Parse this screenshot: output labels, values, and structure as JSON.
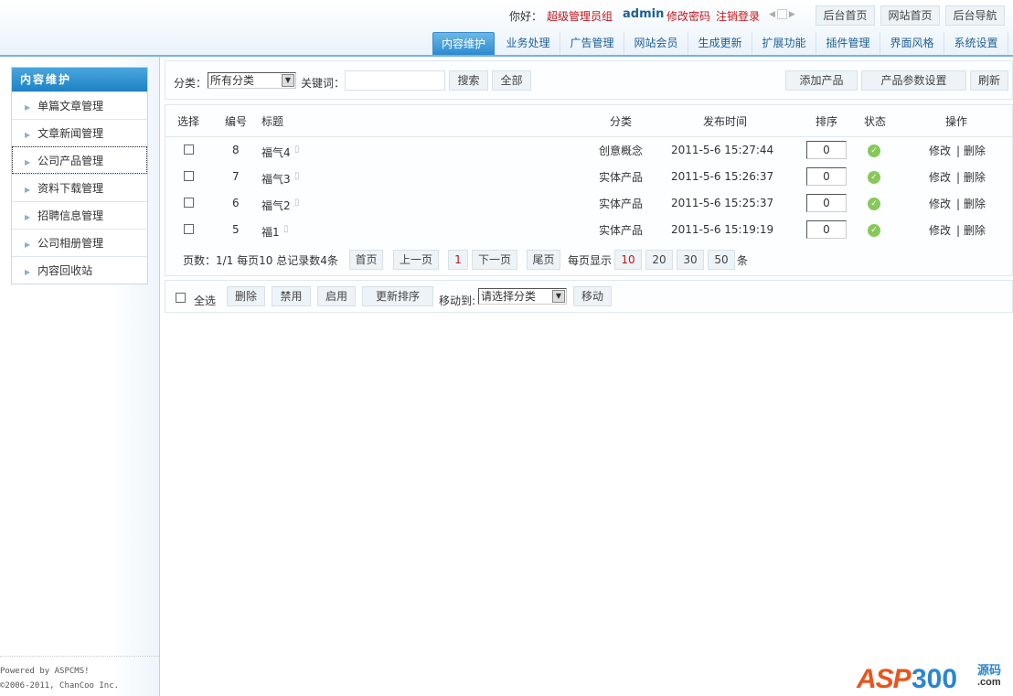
{
  "header": {
    "greeting": "你好：",
    "group": "超级管理员组",
    "user": "admin",
    "change_password": "修改密码",
    "logout": "注销登录",
    "buttons": [
      "后台首页",
      "网站首页",
      "后台导航"
    ]
  },
  "tabs": [
    "内容维护",
    "业务处理",
    "广告管理",
    "网站会员",
    "生成更新",
    "扩展功能",
    "插件管理",
    "界面风格",
    "系统设置"
  ],
  "sidebar": {
    "title": "内容维护",
    "items": [
      "单篇文章管理",
      "文章新闻管理",
      "公司产品管理",
      "资料下载管理",
      "招聘信息管理",
      "公司相册管理",
      "内容回收站"
    ]
  },
  "search": {
    "category_label": "分类：",
    "category_value": "所有分类",
    "keyword_label": "关键词：",
    "keyword_value": "",
    "search": "搜索",
    "all": "全部",
    "add": "添加产品",
    "params": "产品参数设置",
    "refresh": "刷新"
  },
  "table": {
    "headers": [
      "选择",
      "编号",
      "标题",
      "分类",
      "发布时间",
      "排序",
      "状态",
      "操作"
    ],
    "rows": [
      {
        "id": "8",
        "title": "福气4",
        "category": "创意概念",
        "time": "2011-5-6 15:27:44",
        "order": "0",
        "edit": "修改",
        "delete": "| 删除"
      },
      {
        "id": "7",
        "title": "福气3",
        "category": "实体产品",
        "time": "2011-5-6 15:26:37",
        "order": "0",
        "edit": "修改",
        "delete": "| 删除"
      },
      {
        "id": "6",
        "title": "福气2",
        "category": "实体产品",
        "time": "2011-5-6 15:25:37",
        "order": "0",
        "edit": "修改",
        "delete": "| 删除"
      },
      {
        "id": "5",
        "title": "福1",
        "category": "实体产品",
        "time": "2011-5-6 15:19:19",
        "order": "0",
        "edit": "修改",
        "delete": "| 删除"
      }
    ]
  },
  "pager": {
    "info": "页数：1/1 每页10 总记录数4条",
    "first": "首页",
    "prev": "上一页",
    "current": "1",
    "next": "下一页",
    "last": "尾页",
    "per_page_label": "每页显示",
    "sizes": [
      "10",
      "20",
      "30",
      "50"
    ],
    "unit": "条"
  },
  "bulk": {
    "select_all": "全选",
    "delete": "删除",
    "disable": "禁用",
    "enable": "启用",
    "update_order": "更新排序",
    "move_label": "移动到:",
    "move_value": "请选择分类",
    "move": "移动"
  },
  "footer": {
    "powered": "Powered by ASPCMS!",
    "copyright": "©2006-2011, ChanCoo Inc.",
    "logo": "ASP300源码 .com"
  }
}
